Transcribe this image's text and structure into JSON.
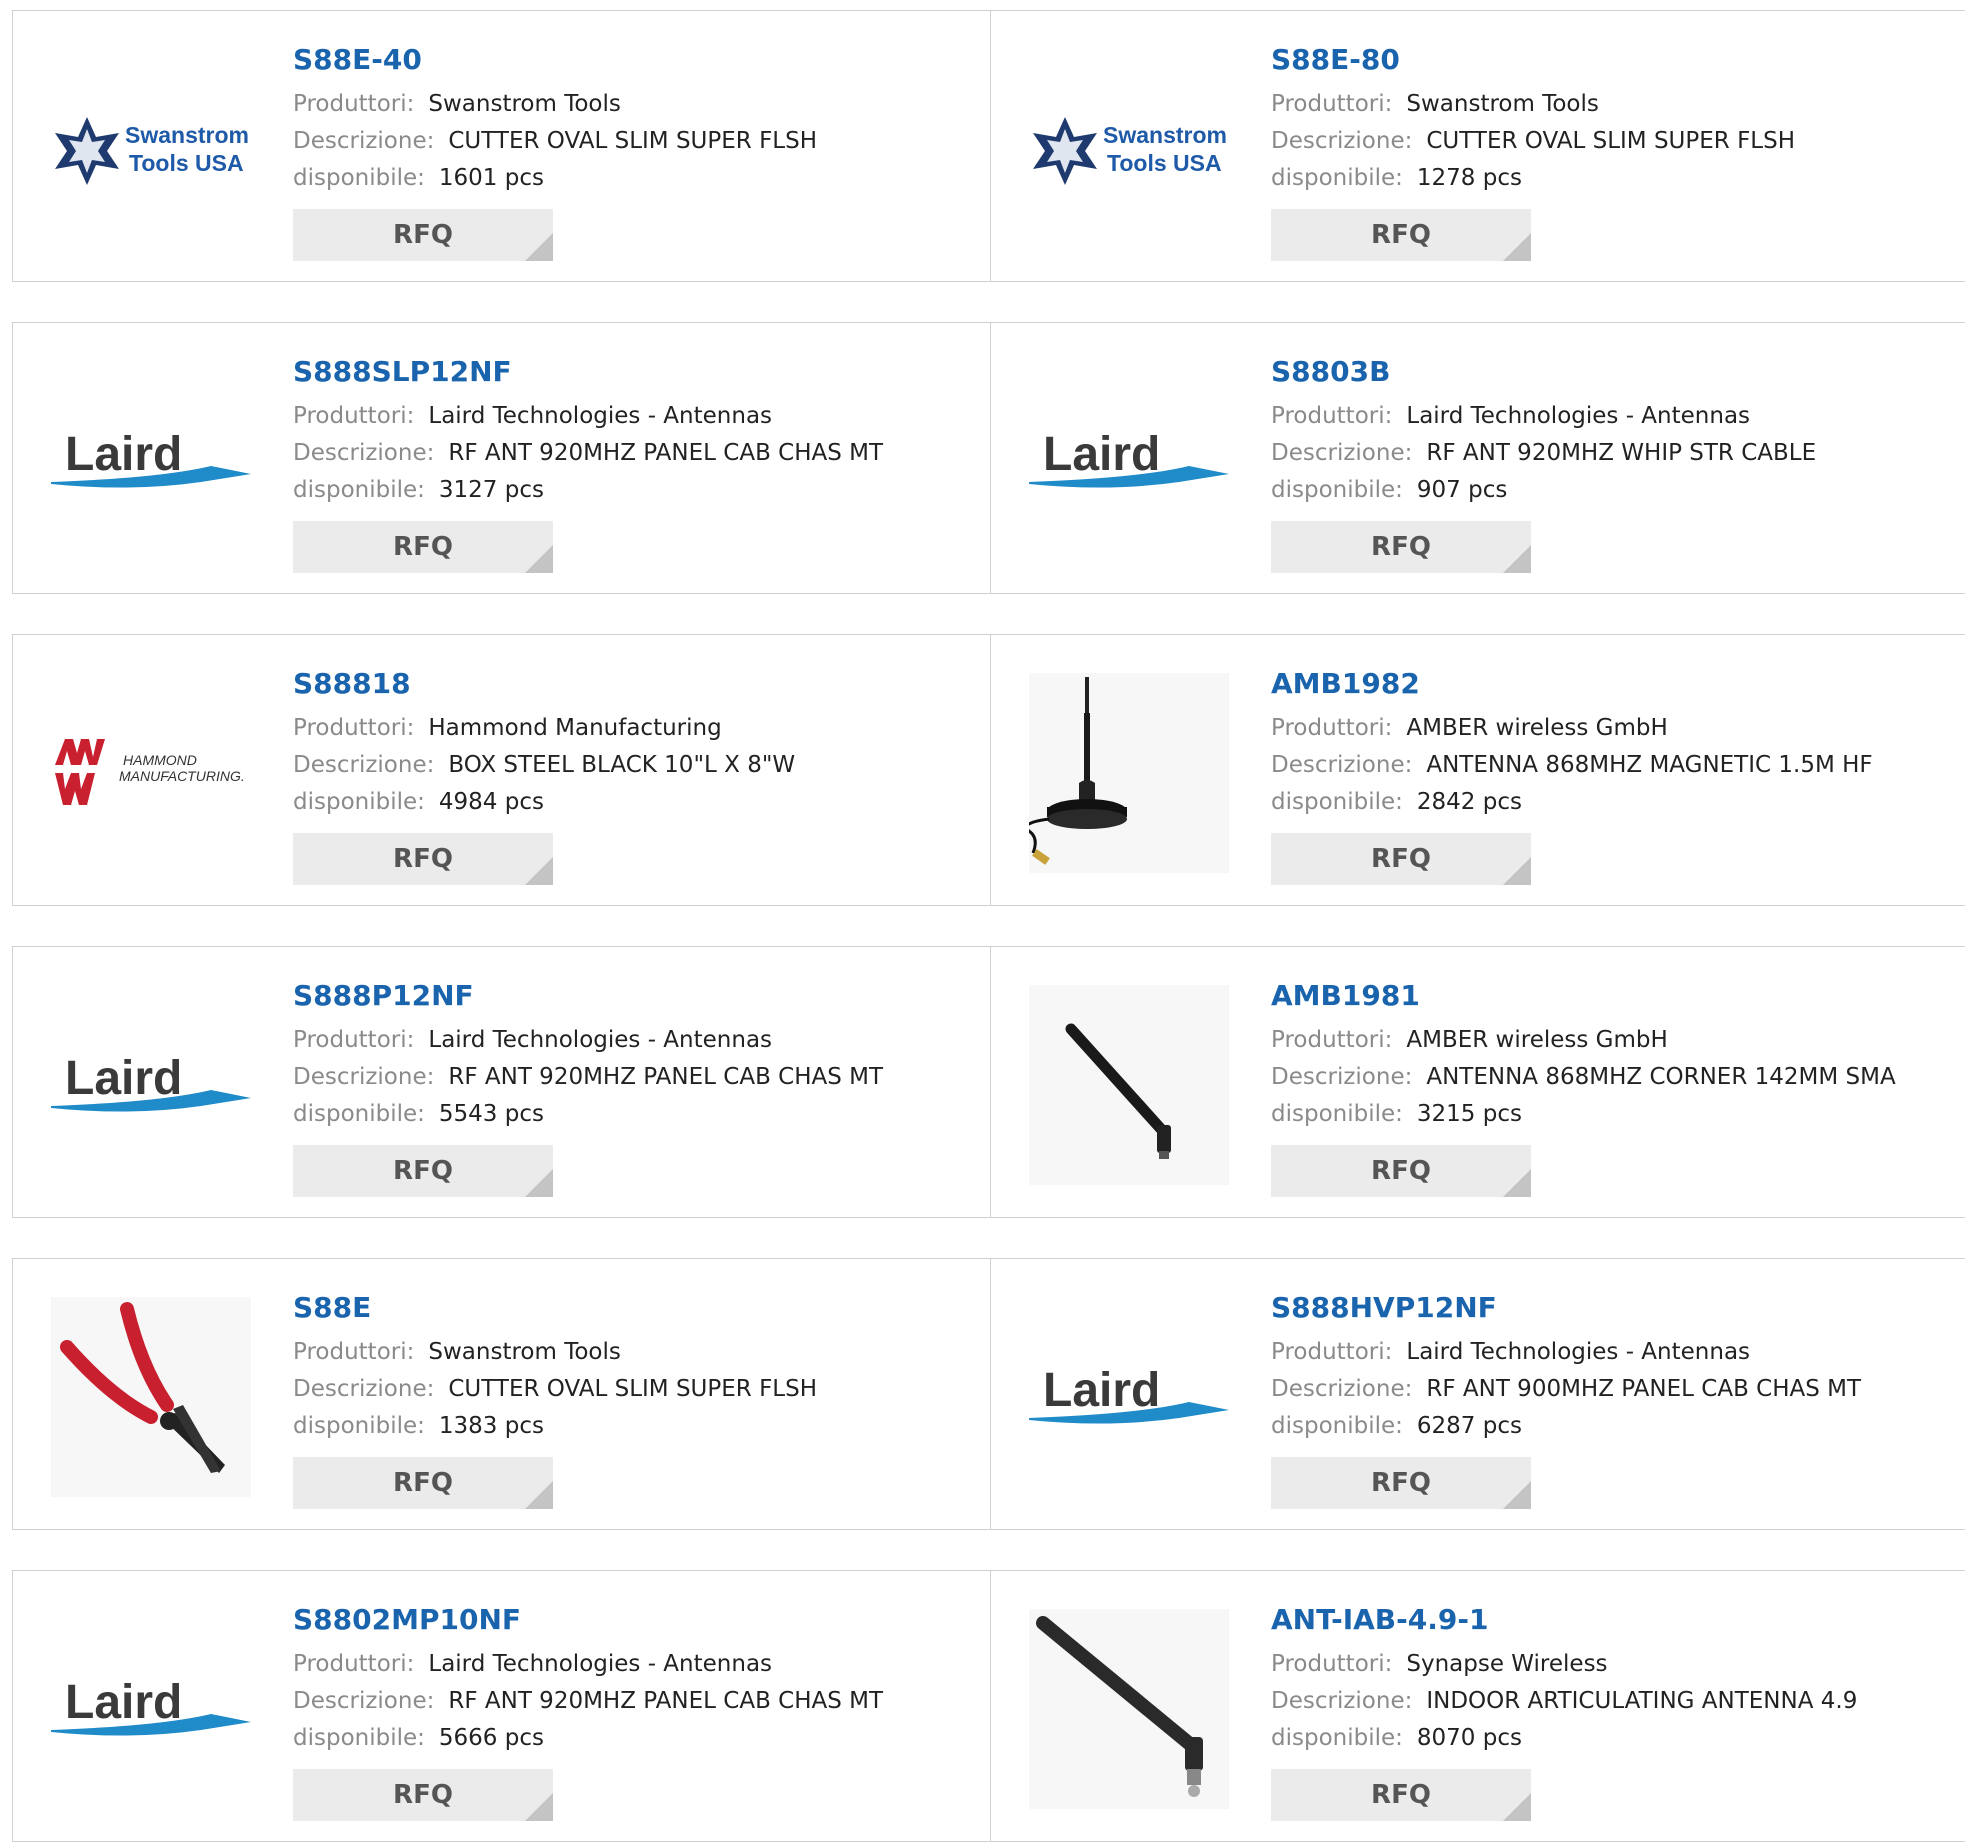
{
  "labels": {
    "producer": "Produttori:",
    "description": "Descrizione:",
    "available": "disponibile:",
    "rfq": "RFQ"
  },
  "colors": {
    "part_number": "#1a63ad",
    "label": "#8a8a8a",
    "rfq_bg": "#ebebeb",
    "laird_blue": "#1f8bc8",
    "hammond_red": "#c8202f",
    "swanstrom_navy": "#1e3a6e"
  },
  "products": [
    {
      "part": "S88E-40",
      "producer": "Swanstrom Tools",
      "description": "CUTTER OVAL SLIM SUPER FLSH",
      "stock": "1601 pcs",
      "logo": "swanstrom-logo",
      "logo_text": [
        "Swanstrom",
        "Tools USA"
      ]
    },
    {
      "part": "S88E-80",
      "producer": "Swanstrom Tools",
      "description": "CUTTER OVAL SLIM SUPER FLSH",
      "stock": "1278 pcs",
      "logo": "swanstrom-logo",
      "logo_text": [
        "Swanstrom",
        "Tools USA"
      ]
    },
    {
      "part": "S888SLP12NF",
      "producer": "Laird Technologies - Antennas",
      "description": "RF ANT 920MHZ PANEL CAB CHAS MT",
      "stock": "3127 pcs",
      "logo": "laird-logo",
      "logo_text": [
        "Laird"
      ]
    },
    {
      "part": "S8803B",
      "producer": "Laird Technologies - Antennas",
      "description": "RF ANT 920MHZ WHIP STR CABLE",
      "stock": "907 pcs",
      "logo": "laird-logo",
      "logo_text": [
        "Laird"
      ]
    },
    {
      "part": "S88818",
      "producer": "Hammond Manufacturing",
      "description": "BOX STEEL BLACK 10\"L X 8\"W",
      "stock": "4984 pcs",
      "logo": "hammond-logo",
      "logo_text": [
        "HAMMOND",
        "MANUFACTURING."
      ]
    },
    {
      "part": "AMB1982",
      "producer": "AMBER wireless GmbH",
      "description": "ANTENNA 868MHZ MAGNETIC 1.5M HF",
      "stock": "2842 pcs",
      "logo": "magnetic-antenna-image",
      "logo_text": []
    },
    {
      "part": "S888P12NF",
      "producer": "Laird Technologies - Antennas",
      "description": "RF ANT 920MHZ PANEL CAB CHAS MT",
      "stock": "5543 pcs",
      "logo": "laird-logo",
      "logo_text": [
        "Laird"
      ]
    },
    {
      "part": "AMB1981",
      "producer": "AMBER wireless GmbH",
      "description": "ANTENNA 868MHZ CORNER 142MM SMA",
      "stock": "3215 pcs",
      "logo": "corner-antenna-image",
      "logo_text": []
    },
    {
      "part": "S88E",
      "producer": "Swanstrom Tools",
      "description": "CUTTER OVAL SLIM SUPER FLSH",
      "stock": "1383 pcs",
      "logo": "cutter-pliers-image",
      "logo_text": []
    },
    {
      "part": "S888HVP12NF",
      "producer": "Laird Technologies - Antennas",
      "description": "RF ANT 900MHZ PANEL CAB CHAS MT",
      "stock": "6287 pcs",
      "logo": "laird-logo",
      "logo_text": [
        "Laird"
      ]
    },
    {
      "part": "S8802MP10NF",
      "producer": "Laird Technologies - Antennas",
      "description": "RF ANT 920MHZ PANEL CAB CHAS MT",
      "stock": "5666 pcs",
      "logo": "laird-logo",
      "logo_text": [
        "Laird"
      ]
    },
    {
      "part": "ANT-IAB-4.9-1",
      "producer": "Synapse Wireless",
      "description": "INDOOR ARTICULATING ANTENNA 4.9",
      "stock": "8070 pcs",
      "logo": "articulating-antenna-image",
      "logo_text": []
    }
  ]
}
